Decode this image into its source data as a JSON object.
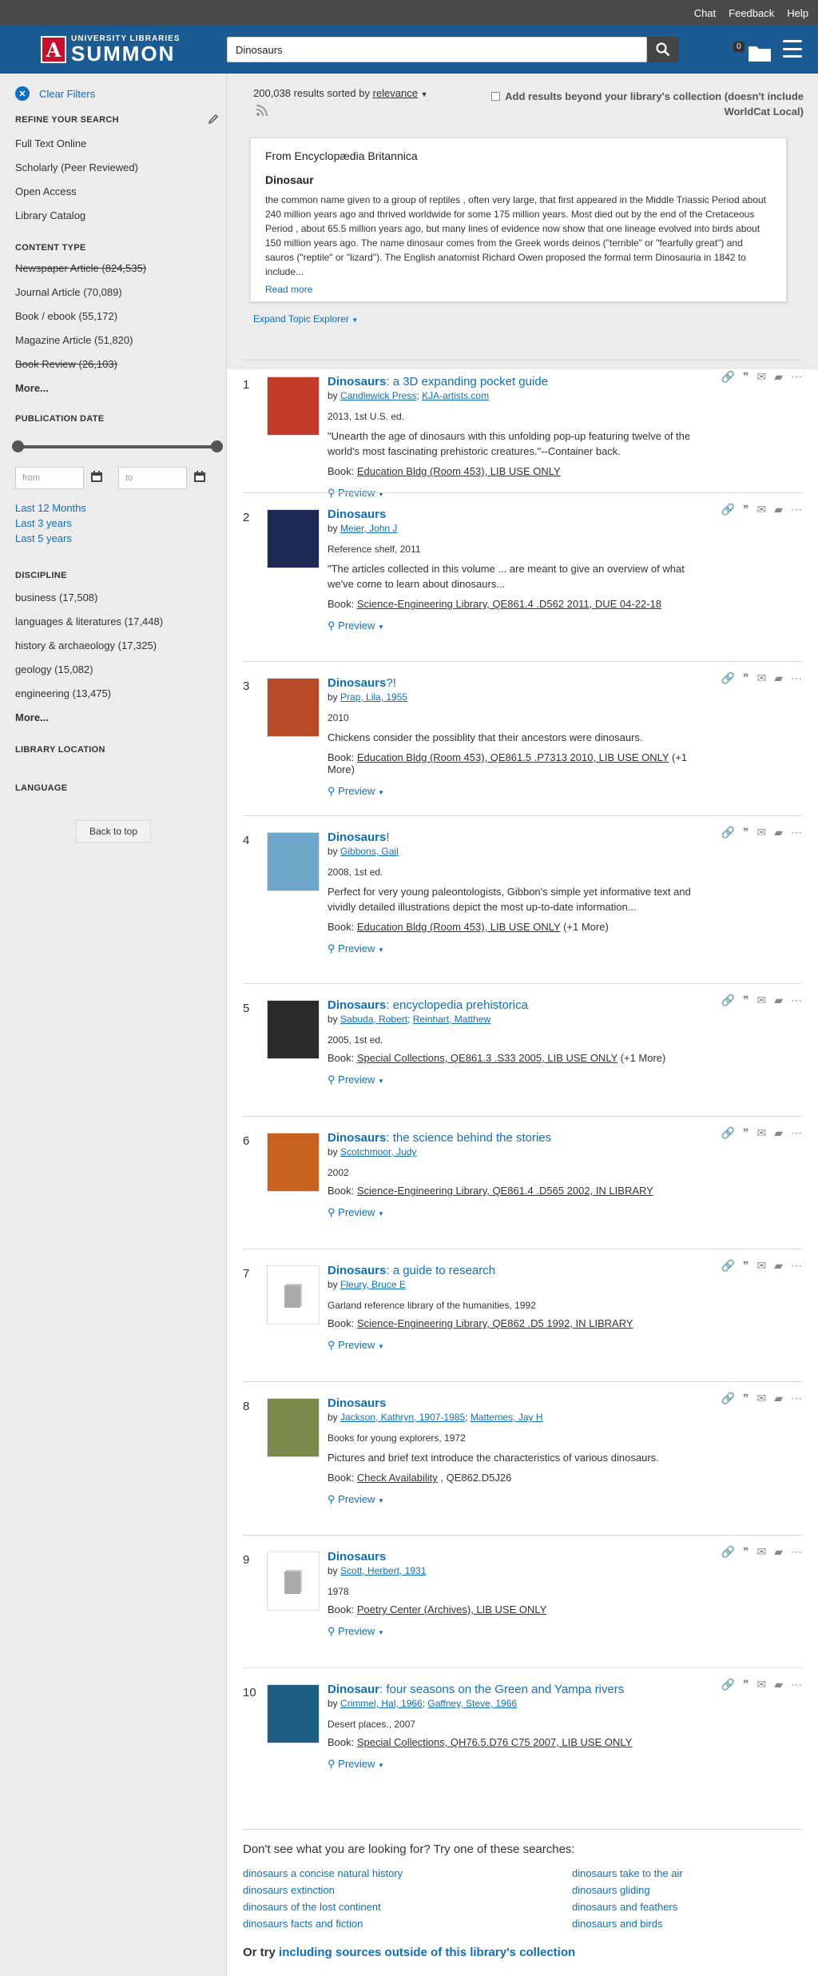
{
  "topbar": {
    "chat": "Chat",
    "feedback": "Feedback",
    "help": "Help"
  },
  "brand": {
    "line1": "UNIVERSITY LIBRARIES",
    "line2": "SUMMON",
    "letter": "A"
  },
  "search": {
    "value": "Dinosaurs"
  },
  "folder": {
    "count": "0"
  },
  "sidebar": {
    "clear": "Clear Filters",
    "refine": "REFINE YOUR SEARCH",
    "refine_items": [
      "Full Text Online",
      "Scholarly (Peer Reviewed)",
      "Open Access",
      "Library Catalog"
    ],
    "content_type": "CONTENT TYPE",
    "ct": [
      {
        "label": "Newspaper Article",
        "count": "(824,535)"
      },
      {
        "label": "Journal Article",
        "count": "(70,089)"
      },
      {
        "label": "Book / ebook",
        "count": "(55,172)"
      },
      {
        "label": "Magazine Article",
        "count": "(51,820)"
      },
      {
        "label": "Book Review",
        "count": "(26,103)"
      }
    ],
    "more1": "More...",
    "pubdate": "PUBLICATION DATE",
    "from": "from",
    "to": "to",
    "last": [
      "Last 12 Months",
      "Last 3 years",
      "Last 5 years"
    ],
    "discipline": "DISCIPLINE",
    "disc": [
      {
        "label": "business",
        "count": "(17,508)"
      },
      {
        "label": "languages & literatures",
        "count": "(17,448)"
      },
      {
        "label": "history & archaeology",
        "count": "(17,325)"
      },
      {
        "label": "geology",
        "count": "(15,082)"
      },
      {
        "label": "engineering",
        "count": "(13,475)"
      }
    ],
    "more2": "More...",
    "libloc": "LIBRARY LOCATION",
    "language": "LANGUAGE",
    "back": "Back to top"
  },
  "results_header": {
    "count": "200,038 results sorted by",
    "sort": "relevance",
    "beyond": "Add results beyond your library's collection (doesn't include WorldCat Local)"
  },
  "encyclopedia": {
    "source": "From Encyclopædia Britannica",
    "title": "Dinosaur",
    "text": "the common name given to a group of reptiles , often very large, that first appeared in the Middle Triassic Period about 240 million years ago and thrived worldwide for some 175 million years. Most died out by the end of the Cretaceous Period , about 65.5 million years ago, but many lines of evidence now show that one lineage evolved into birds about 150 million years ago. The name dinosaur comes from the Greek words deinos (\"terrible\" or \"fearfully great\") and sauros (\"reptile\" or \"lizard\"). The English anatomist Richard Owen proposed the formal term Dinosauria in 1842 to include...",
    "readmore": "Read more"
  },
  "explorer": "Expand Topic Explorer",
  "preview": "Preview",
  "results": [
    {
      "n": "1",
      "title_b": "Dinosaurs",
      "title_r": ": a 3D expanding pocket guide",
      "by": "by",
      "authors": [
        "Candlewick Press",
        "KJA-artists.com"
      ],
      "meta": "2013, 1st U.S. ed.",
      "snip": "\"Unearth the age of dinosaurs with this unfolding pop-up featuring twelve of the world's most fascinating prehistoric creatures.\"--Container back.",
      "label": "Book:",
      "loc": "Education Bldg (Room 453), LIB USE ONLY",
      "extra": "",
      "cover": "#c43b2a"
    },
    {
      "n": "2",
      "title_b": "Dinosaurs",
      "title_r": "",
      "by": "by",
      "authors": [
        "Meier, John J"
      ],
      "meta": "Reference shelf, 2011",
      "snip": "\"The articles collected in this volume ... are meant to give an overview of what we've come to learn about dinosaurs...",
      "label": "Book:",
      "loc": "Science-Engineering Library, QE861.4 .D562 2011, DUE 04-22-18",
      "extra": "",
      "cover": "#1e2a55"
    },
    {
      "n": "3",
      "title_b": "Dinosaurs",
      "title_r": "?!",
      "by": "by",
      "authors": [
        "Prap, Lila, 1955"
      ],
      "meta": "2010",
      "snip": "Chickens consider the possiblity that their ancestors were dinosaurs.",
      "label": "Book:",
      "loc": "Education Bldg (Room 453), QE861.5 .P7313 2010, LIB USE ONLY",
      "extra": "(+1 More)",
      "cover": "#b84a2a"
    },
    {
      "n": "4",
      "title_b": "Dinosaurs",
      "title_r": "!",
      "by": "by",
      "authors": [
        "Gibbons, Gail"
      ],
      "meta": "2008, 1st ed.",
      "snip": "Perfect for very young paleontologists, Gibbon's simple yet informative text and vividly detailed illustrations depict the most up-to-date information...",
      "label": "Book:",
      "loc": "Education Bldg (Room 453), LIB USE ONLY",
      "extra": "(+1 More)",
      "cover": "#6da6c8"
    },
    {
      "n": "5",
      "title_b": "Dinosaurs",
      "title_r": ": encyclopedia prehistorica",
      "by": "by",
      "authors": [
        "Sabuda, Robert",
        "Reinhart, Matthew"
      ],
      "meta": "2005, 1st ed.",
      "snip": "",
      "label": "Book:",
      "loc": "Special Collections, QE861.3 .S33 2005, LIB USE ONLY",
      "extra": "(+1 More)",
      "cover": "#2a2a2a"
    },
    {
      "n": "6",
      "title_b": "Dinosaurs",
      "title_r": ": the science behind the stories",
      "by": "by",
      "authors": [
        "Scotchmoor, Judy"
      ],
      "meta": "2002",
      "snip": "",
      "label": "Book:",
      "loc": "Science-Engineering Library, QE861.4 .D565 2002, IN LIBRARY",
      "extra": "",
      "cover": "#c9611f"
    },
    {
      "n": "7",
      "title_b": "Dinosaurs",
      "title_r": ": a guide to research",
      "by": "by",
      "authors": [
        "Fleury, Bruce E"
      ],
      "meta": "Garland reference library of the humanities, 1992",
      "snip": "",
      "label": "Book:",
      "loc": "Science-Engineering Library, QE862 .D5 1992, IN LIBRARY",
      "extra": "",
      "cover": "plain"
    },
    {
      "n": "8",
      "title_b": "Dinosaurs",
      "title_r": "",
      "by": "by",
      "authors": [
        "Jackson, Kathryn, 1907-1985",
        "Matternes, Jay H"
      ],
      "meta": "Books for young explorers, 1972",
      "snip": "Pictures and brief text introduce the characteristics of various dinosaurs.",
      "label": "Book:",
      "loc": "Check Availability",
      "extra": ", QE862.D5J26",
      "cover": "#7b8a4a"
    },
    {
      "n": "9",
      "title_b": "Dinosaurs",
      "title_r": "",
      "by": "by",
      "authors": [
        "Scott, Herbert, 1931"
      ],
      "meta": "1978",
      "snip": "",
      "label": "Book:",
      "loc": "Poetry Center (Archives), LIB USE ONLY",
      "extra": "",
      "cover": "plain"
    },
    {
      "n": "10",
      "title_b": "Dinosaur",
      "title_r": ": four seasons on the Green and Yampa rivers",
      "by": "by",
      "authors": [
        "Crimmel, Hal, 1966",
        "Gaffney, Steve, 1966"
      ],
      "meta": "Desert places., 2007",
      "snip": "",
      "label": "Book:",
      "loc": "Special Collections, QH76.5.D76 C75 2007, LIB USE ONLY",
      "extra": "",
      "cover": "#1f5d84"
    }
  ],
  "suggestions": {
    "heading": "Don't see what you are looking for? Try one of these searches:",
    "items": [
      "dinosaurs a concise natural history",
      "dinosaurs take to the air",
      "dinosaurs extinction",
      "dinosaurs gliding",
      "dinosaurs of the lost continent",
      "dinosaurs and feathers",
      "dinosaurs facts and fiction",
      "dinosaurs and birds"
    ],
    "ortry": "Or try",
    "ortry_link": "including sources outside of this library's collection"
  }
}
